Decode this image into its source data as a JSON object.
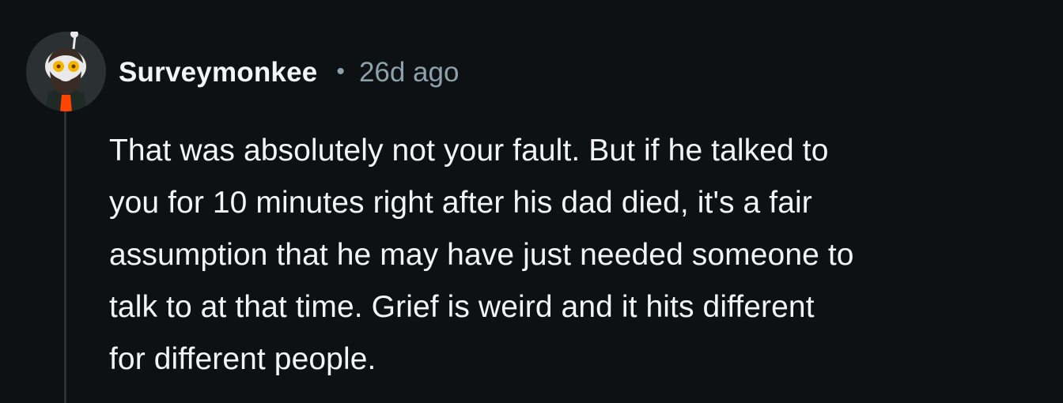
{
  "comment": {
    "author": "Surveymonkee",
    "separator": "•",
    "age": "26d ago",
    "avatar_icon": "snoo-avatar-icon",
    "body_lines": [
      "That was absolutely not your fault. But if he talked to",
      "you for 10 minutes right after his dad died, it's a fair",
      "assumption that he may have just needed someone to",
      "talk to at that time. Grief is weird and it hits different",
      "for different people."
    ]
  },
  "colors": {
    "background": "#0e1113",
    "text_primary": "#f2f4f5",
    "text_secondary": "#8ba2ad",
    "thread_line": "#2a3236"
  }
}
